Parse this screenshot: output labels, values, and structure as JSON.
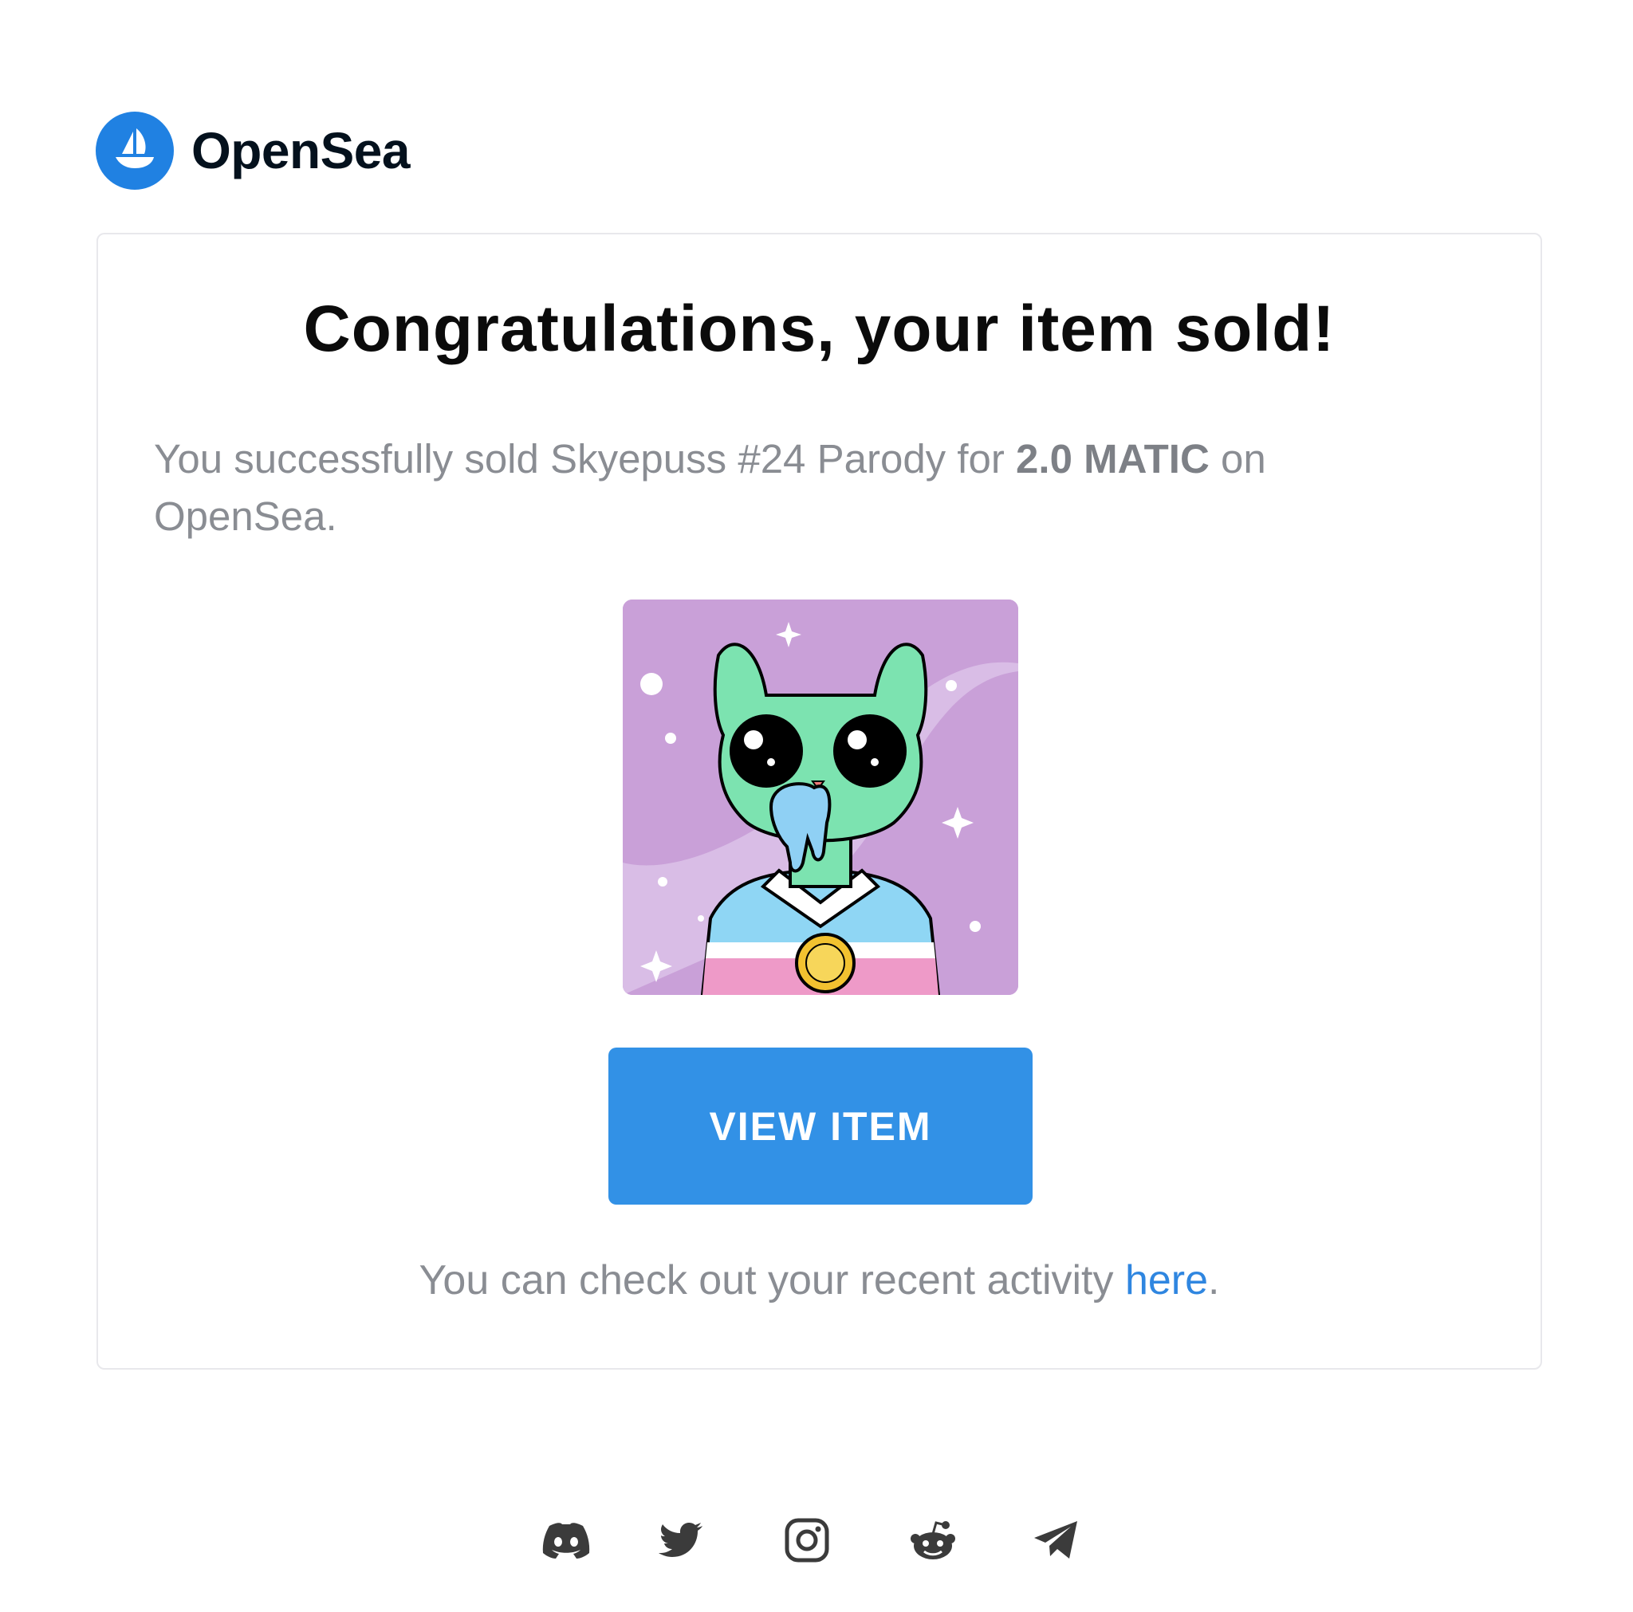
{
  "brand": {
    "name": "OpenSea",
    "logo_icon": "opensea-ship-icon",
    "color": "#2081e2"
  },
  "card": {
    "title": "Congratulations, your item sold!",
    "message": {
      "prefix": "You successfully sold Skyepuss #24 Parody for ",
      "price": "2.0 MATIC",
      "suffix": " on OpenSea."
    },
    "image_alt": "Skyepuss #24 Parody",
    "button_label": "VIEW ITEM",
    "activity": {
      "prefix": "You can check out your recent activity ",
      "link_text": "here",
      "suffix": "."
    }
  },
  "socials": [
    {
      "icon": "discord-icon"
    },
    {
      "icon": "twitter-icon"
    },
    {
      "icon": "instagram-icon"
    },
    {
      "icon": "reddit-icon"
    },
    {
      "icon": "telegram-icon"
    }
  ],
  "colors": {
    "button": "#3291e6",
    "link": "#2f86e0",
    "muted_text": "#8a8d93",
    "nft_background": "#c9a0d8"
  }
}
